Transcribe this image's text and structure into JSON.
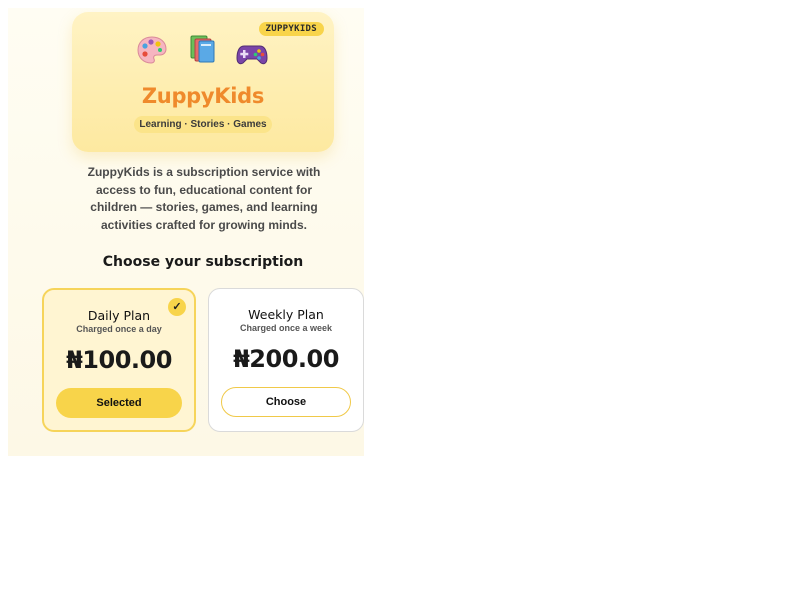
{
  "brand": {
    "badge": "ZUPPYKIDS",
    "name": "ZuppyKids",
    "tagline": "Learning · Stories · Games",
    "icons": [
      "palette-icon",
      "books-icon",
      "gamepad-icon"
    ]
  },
  "description": "ZuppyKids is a subscription service with access to fun, educational content for children — stories, games, and learning activities crafted for growing minds.",
  "section_title": "Choose your subscription",
  "plans": [
    {
      "name": "Daily Plan",
      "note": "Charged once a day",
      "price": "₦100.00",
      "button": "Selected",
      "selected": true,
      "check": "✓"
    },
    {
      "name": "Weekly Plan",
      "note": "Charged once a week",
      "price": "₦200.00",
      "button": "Choose",
      "selected": false
    }
  ],
  "colors": {
    "accent": "#f8d44a",
    "brand": "#ef8a2c",
    "hero_bg": "#fdeaa6"
  }
}
